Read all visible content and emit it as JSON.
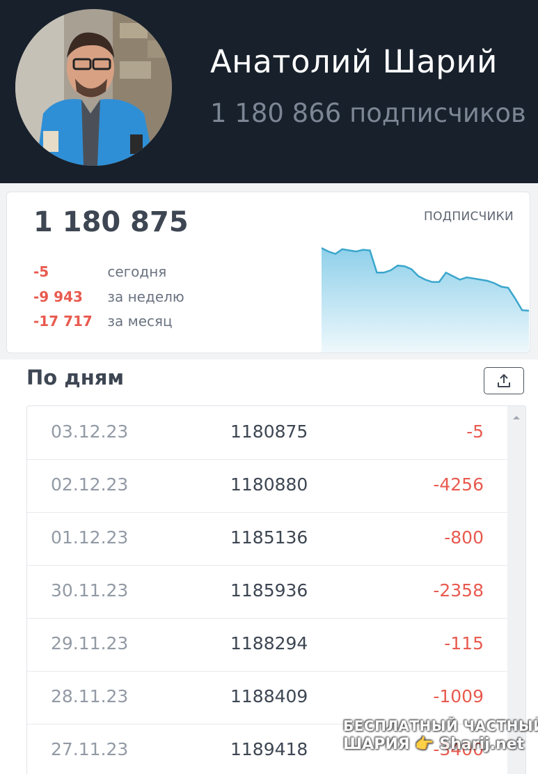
{
  "header": {
    "channel_name": "Анатолий Шарий",
    "subscribers_text": "1 180 866 подписчиков"
  },
  "stats": {
    "total": "1 180 875",
    "deltas": [
      {
        "value": "-5",
        "label": "сегодня"
      },
      {
        "value": "-9 943",
        "label": "за неделю"
      },
      {
        "value": "-17 717",
        "label": "за месяц"
      }
    ],
    "sparkline_label": "ПОДПИСЧИКИ",
    "sparkline_color": "#3aa6cc"
  },
  "chart_data": {
    "type": "area",
    "values": [
      1198600,
      1198300,
      1198100,
      1198500,
      1198400,
      1198300,
      1198450,
      1198400,
      1196500,
      1196500,
      1196700,
      1197100,
      1197050,
      1196800,
      1196200,
      1195900,
      1195700,
      1195700,
      1196500,
      1196200,
      1195900,
      1196100,
      1196000,
      1195900,
      1195800,
      1195600,
      1195300,
      1195200,
      1194300,
      1193300,
      1193250
    ]
  },
  "section": {
    "title": "По дням",
    "export_icon": "share-export-icon"
  },
  "table": {
    "rows": [
      {
        "date": "03.12.23",
        "count": "1180875",
        "change": "-5"
      },
      {
        "date": "02.12.23",
        "count": "1180880",
        "change": "-4256"
      },
      {
        "date": "01.12.23",
        "count": "1185136",
        "change": "-800"
      },
      {
        "date": "30.11.23",
        "count": "1185936",
        "change": "-2358"
      },
      {
        "date": "29.11.23",
        "count": "1188294",
        "change": "-115"
      },
      {
        "date": "28.11.23",
        "count": "1188409",
        "change": "-1009"
      },
      {
        "date": "27.11.23",
        "count": "1189418",
        "change": "-3400"
      }
    ]
  },
  "watermark": {
    "line1": "БЕСПЛАТНЫЙ ЧАСТНЫЙ",
    "line2": "ШАРИЯ 👉 Sharij.net"
  }
}
